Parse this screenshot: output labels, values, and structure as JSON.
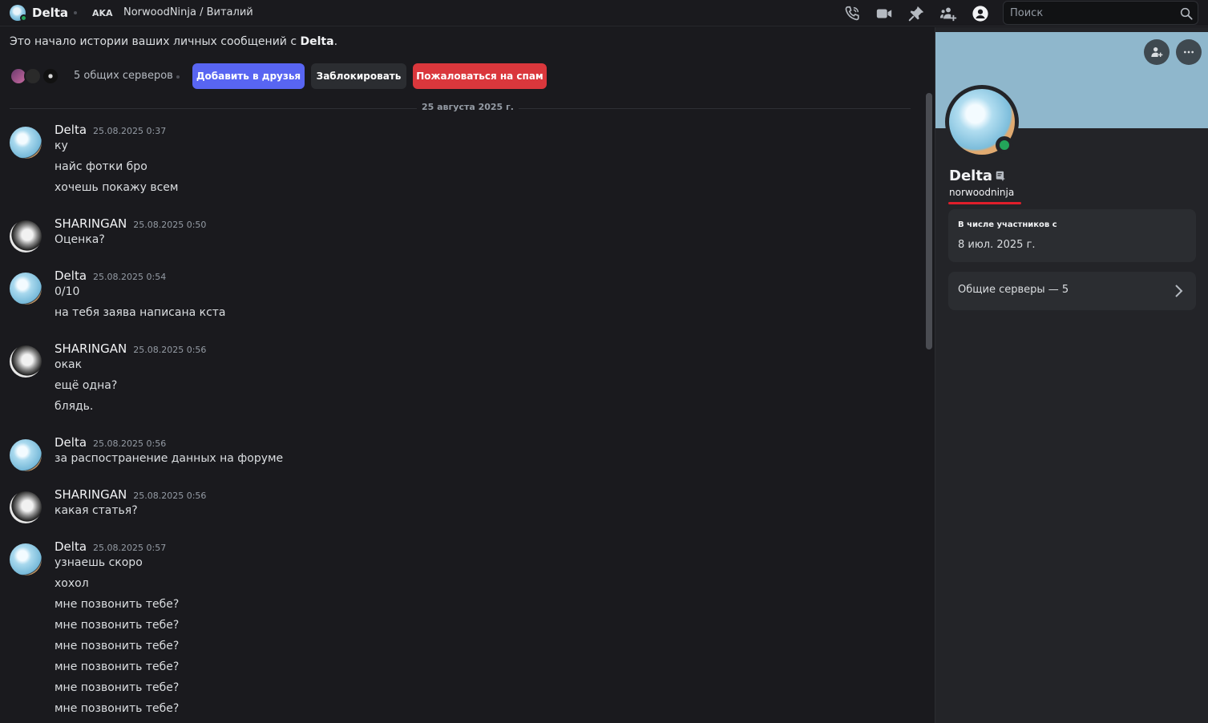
{
  "header": {
    "name": "Delta",
    "aka_label": "AKA",
    "aka_names": "NorwoodNinja / Виталий",
    "search_placeholder": "Поиск",
    "icons": [
      "voice-call-icon",
      "video-call-icon",
      "pin-icon",
      "add-friends-to-dm-icon",
      "user-profile-icon",
      "search-icon"
    ]
  },
  "chat": {
    "intro_prefix": "Это начало истории ваших личных сообщений с ",
    "intro_name": "Delta",
    "intro_suffix": ".",
    "mutual_servers": "5 общих серверов",
    "buttons": {
      "add_friend": "Добавить в друзья",
      "block": "Заблокировать",
      "report_spam": "Пожаловаться на спам"
    },
    "date_divider": "25 августа 2025 г.",
    "groups": [
      {
        "author": "Delta",
        "time": "25.08.2025 0:37",
        "lines": [
          "ку",
          "найс фотки бро",
          "хочешь покажу всем"
        ]
      },
      {
        "author": "SHARINGAN",
        "time": "25.08.2025 0:50",
        "lines": [
          "Оценка?"
        ]
      },
      {
        "author": "Delta",
        "time": "25.08.2025 0:54",
        "lines": [
          "0/10",
          "на тебя заява написана кста"
        ]
      },
      {
        "author": "SHARINGAN",
        "time": "25.08.2025 0:56",
        "lines": [
          "окак",
          "ещё одна?",
          "блядь."
        ]
      },
      {
        "author": "Delta",
        "time": "25.08.2025 0:56",
        "lines": [
          "за распостранение данных на форуме"
        ]
      },
      {
        "author": "SHARINGAN",
        "time": "25.08.2025 0:56",
        "lines": [
          "какая статья?"
        ]
      },
      {
        "author": "Delta",
        "time": "25.08.2025 0:57",
        "lines": [
          "узнаешь скоро",
          "хохол",
          "мне позвонить тебе?",
          "мне позвонить тебе?",
          "мне позвонить тебе?",
          "мне позвонить тебе?",
          "мне позвонить тебе?",
          "мне позвонить тебе?"
        ]
      }
    ]
  },
  "profile": {
    "display_name": "Delta",
    "username": "norwoodninja",
    "member_since_label": "В числе участников с",
    "member_since_value": "8 июл. 2025 г.",
    "mutual_servers_label": "Общие серверы — 5",
    "status": "online",
    "colors": {
      "banner": "#8fb7cc",
      "online": "#23a55a",
      "highlight": "#e01e2b"
    }
  },
  "colors": {
    "primary_button": "#5865f2",
    "danger_button": "#da373c",
    "background": "#1a1a1e"
  }
}
